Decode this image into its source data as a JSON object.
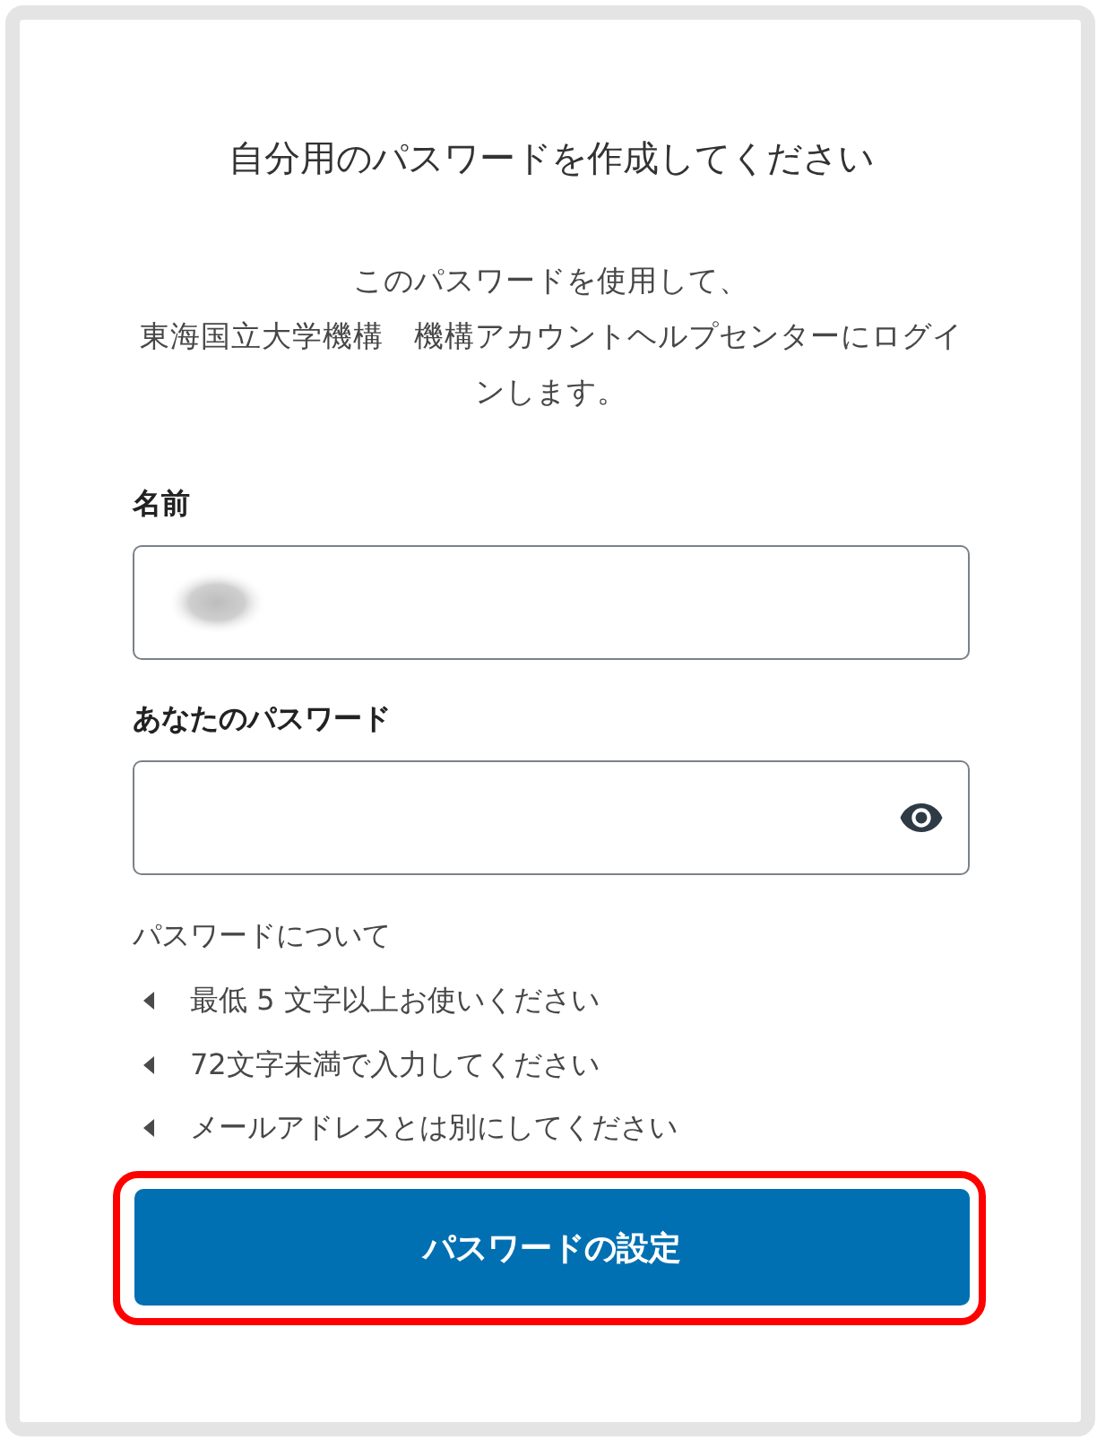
{
  "title": "自分用のパスワードを作成してください",
  "description": [
    "このパスワードを使用して、",
    "東海国立大学機構　機構アカウントヘルプセンターにログインします。"
  ],
  "fields": [
    {
      "kind": "text",
      "label": "名前",
      "value_blurred": true
    },
    {
      "kind": "password",
      "label": "あなたのパスワード"
    }
  ],
  "rules": {
    "heading": "パスワードについて",
    "items": [
      "最低 5 文字以上お使いください",
      "72文字未満で入力してください",
      "メールアドレスとは別にしてください"
    ]
  },
  "submit_button": {
    "label": "パスワードの設定",
    "highlighted": true
  }
}
